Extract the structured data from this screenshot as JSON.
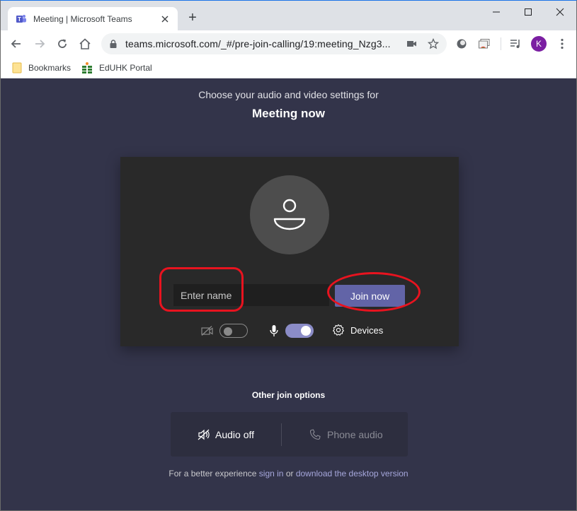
{
  "browser": {
    "tab": {
      "title": "Meeting | Microsoft Teams",
      "favicon": "teams-icon"
    },
    "new_tab_label": "+",
    "address_bar": {
      "url": "teams.microsoft.com/_#/pre-join-calling/19:meeting_Nzg3..."
    },
    "profile_initial": "K",
    "profile_color": "#7b1fa2",
    "bookmarks": [
      {
        "label": "Bookmarks",
        "icon": "folder-icon"
      },
      {
        "label": "EdUHK Portal",
        "icon": "eduhk-icon"
      }
    ]
  },
  "prejoin": {
    "subtitle": "Choose your audio and video settings for",
    "meeting_title": "Meeting now",
    "name_placeholder": "Enter name",
    "name_value": "",
    "join_label": "Join now",
    "camera_enabled": false,
    "mic_enabled": true,
    "devices_label": "Devices",
    "other_options_title": "Other join options",
    "options": [
      {
        "label": "Audio off",
        "icon": "speaker-off-icon",
        "enabled": true
      },
      {
        "label": "Phone audio",
        "icon": "phone-icon",
        "enabled": false
      }
    ],
    "footer": {
      "prefix": "For a better experience ",
      "sign_in": "sign in",
      "middle": " or ",
      "download": "download the desktop version"
    }
  },
  "colors": {
    "accent": "#6264a7",
    "page_bg": "#33344a",
    "card_bg": "#292929",
    "annotation": "#e8131f",
    "link": "#a6a7dc"
  }
}
